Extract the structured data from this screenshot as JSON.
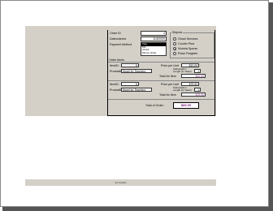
{
  "footer": {
    "text": "24 Credits"
  },
  "order": {
    "order_id_label": "Order ID",
    "order_id_value": "4",
    "date_ordered_label": "Dateordered",
    "date_ordered_value": "11/8/2000",
    "payment_method_label": "Payment Method",
    "payment_options": [
      "Visa",
      "MC",
      "Check",
      "Money Order"
    ],
    "payment_selected": "Visa"
  },
  "shipvia": {
    "label": "Shipvia",
    "options": [
      {
        "label": "Ghost Services",
        "selected": false
      },
      {
        "label": "Courier Post",
        "selected": false
      },
      {
        "label": "Victoria Sporss",
        "selected": true
      },
      {
        "label": "Pulse Freighter",
        "selected": false
      }
    ]
  },
  "items_label": "Order Items",
  "items": [
    {
      "item_id_label": "ItemID:",
      "item_id_value": "5",
      "price_label": "Price per Unit",
      "price_value": "$10.00",
      "product_label": "ProductID:",
      "product_value": "Novel for Teachers",
      "qty_label": "Subscription Length (in Years)",
      "qty_value": "1",
      "total_label": "Total for Item",
      "total_value": "$10.00"
    },
    {
      "item_id_label": "ItemID:",
      "item_id_value": "6",
      "price_label": "Price per Unit",
      "price_value": "$79.90",
      "product_label": "ProductID:",
      "product_value": "Novel for Teachers",
      "qty_label": "Subscription Length (in Years)",
      "qty_value": "1",
      "total_label": "Total for Item",
      "total_value": "$79.90"
    }
  ],
  "grand_total_label": "Total of Order:",
  "grand_total_value": "$89.90"
}
